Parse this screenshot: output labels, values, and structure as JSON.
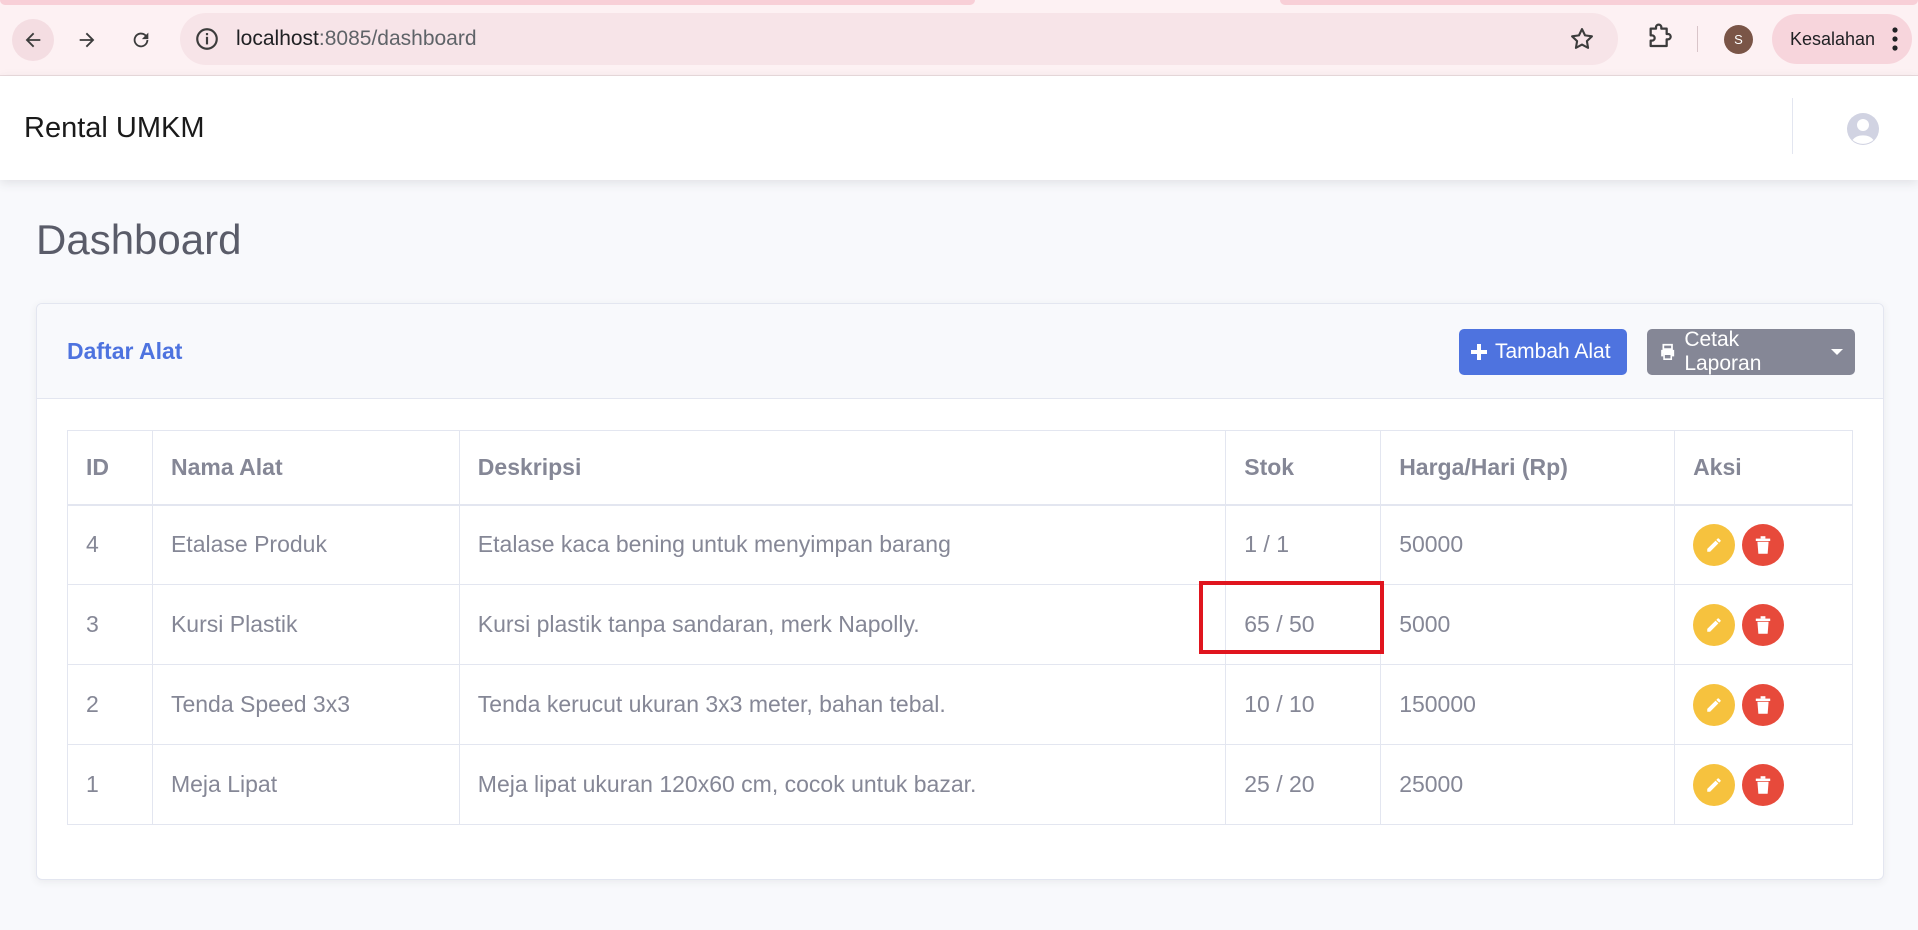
{
  "browser": {
    "url_host": "localhost",
    "url_rest": ":8085/dashboard",
    "profile_initial": "S",
    "error_label": "Kesalahan"
  },
  "app": {
    "brand": "Rental UMKM"
  },
  "page": {
    "title": "Dashboard"
  },
  "card": {
    "title": "Daftar Alat",
    "add_button": "Tambah Alat",
    "print_button": "Cetak Laporan"
  },
  "table": {
    "headers": [
      "ID",
      "Nama Alat",
      "Deskripsi",
      "Stok",
      "Harga/Hari (Rp)",
      "Aksi"
    ],
    "rows": [
      {
        "id": "4",
        "name": "Etalase Produk",
        "desc": "Etalase kaca bening untuk menyimpan barang",
        "stok": "1 / 1",
        "harga": "50000"
      },
      {
        "id": "3",
        "name": "Kursi Plastik",
        "desc": "Kursi plastik tanpa sandaran, merk Napolly.",
        "stok": "65 / 50",
        "harga": "5000"
      },
      {
        "id": "2",
        "name": "Tenda Speed 3x3",
        "desc": "Tenda kerucut ukuran 3x3 meter, bahan tebal.",
        "stok": "10 / 10",
        "harga": "150000"
      },
      {
        "id": "1",
        "name": "Meja Lipat",
        "desc": "Meja lipat ukuran 120x60 cm, cocok untuk bazar.",
        "stok": "25 / 20",
        "harga": "25000"
      }
    ]
  },
  "icons": {
    "back": "arrow-left-icon",
    "forward": "arrow-right-icon",
    "reload": "reload-icon",
    "info": "info-icon",
    "star": "star-icon",
    "extensions": "puzzle-icon",
    "menu": "kebab-menu-icon",
    "user": "user-circle-icon",
    "add": "plus-icon",
    "print": "printer-icon",
    "edit": "pencil-icon",
    "delete": "trash-icon"
  },
  "colors": {
    "primary": "#4e73df",
    "secondary": "#858796",
    "warning": "#f6c23e",
    "danger": "#e74a3b",
    "highlight_box": "#e0151e"
  }
}
